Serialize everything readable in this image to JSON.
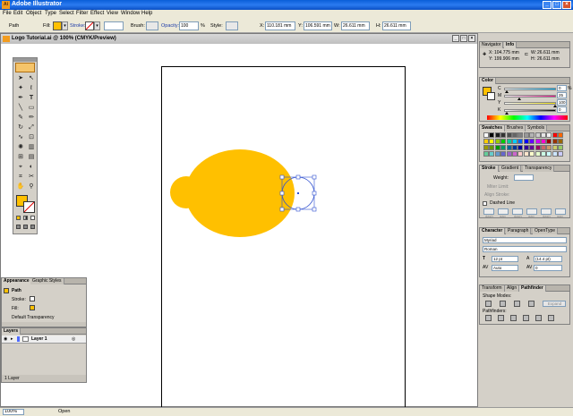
{
  "app": {
    "title": "Adobe Illustrator",
    "logo": "Ai"
  },
  "menu": [
    "File",
    "Edit",
    "Object",
    "Type",
    "Select",
    "Filter",
    "Effect",
    "View",
    "Window",
    "Help"
  ],
  "control": {
    "object_type": "Path",
    "fill_label": "Fill:",
    "fill_color": "#ffc000",
    "stroke_label": "Stroke:",
    "brush_label": "Brush:",
    "opacity_label": "Opacity:",
    "opacity_value": "100",
    "opacity_unit": "%",
    "style_label": "Style:",
    "x_label": "X:",
    "x_value": "110.181 mm",
    "y_label": "Y:",
    "y_value": "106.591 mm",
    "w_label": "W:",
    "w_value": "26.611 mm",
    "h_label": "H:",
    "h_value": "26.611 mm"
  },
  "document": {
    "title": "Logo Tutorial.ai @ 100% (CMYK/Preview)",
    "shape_color": "#ffc000"
  },
  "status": {
    "zoom": "100%",
    "info": "Open"
  },
  "navigator_panel": {
    "tabs": [
      "Navigator",
      "Info"
    ],
    "x_label": "X:",
    "x_value": "104.775 mm",
    "y_label": "Y:",
    "y_value": "199.906 mm",
    "w_label": "W:",
    "w_value": "26.611 mm",
    "h_label": "H:",
    "h_value": "26.611 mm"
  },
  "color_panel": {
    "tab": "Color",
    "channels": [
      {
        "label": "C",
        "value": "0",
        "color": "#00a8e8"
      },
      {
        "label": "M",
        "value": "25",
        "color": "#e8128a"
      },
      {
        "label": "Y",
        "value": "100",
        "color": "#f0e010"
      },
      {
        "label": "K",
        "value": "0",
        "color": "#000000"
      }
    ],
    "unit": "%"
  },
  "swatches_panel": {
    "tabs": [
      "Swatches",
      "Brushes",
      "Symbols"
    ],
    "colors": [
      "#ffffff",
      "#000000",
      "#1a1a1a",
      "#333333",
      "#4d4d4d",
      "#666666",
      "#808080",
      "#999999",
      "#b3b3b3",
      "#cccccc",
      "#e6e6e6",
      "#f2f2f2",
      "#ff0000",
      "#ff6600",
      "#ffcc00",
      "#ffff00",
      "#99cc00",
      "#00cc00",
      "#00cc99",
      "#00ccff",
      "#0066ff",
      "#0000ff",
      "#6600ff",
      "#cc00ff",
      "#ff00cc",
      "#990000",
      "#993300",
      "#996600",
      "#999900",
      "#669900",
      "#009900",
      "#009966",
      "#006699",
      "#003399",
      "#000099",
      "#330099",
      "#660099",
      "#990066",
      "#cc6666",
      "#cc9966",
      "#cccc66",
      "#99cc66",
      "#66cc99",
      "#66cccc",
      "#6699cc",
      "#6666cc",
      "#9966cc",
      "#cc66cc",
      "#ffcccc",
      "#ffe5cc",
      "#ffffcc",
      "#e5ffcc",
      "#ccffe5",
      "#ccffff",
      "#cce5ff",
      "#ccccff"
    ]
  },
  "stroke_panel": {
    "tabs": [
      "Stroke",
      "Gradient",
      "Transparency"
    ],
    "weight_label": "Weight:",
    "miter_label": "Miter Limit:",
    "align_label": "Align Stroke:",
    "dashed_label": "Dashed Line",
    "dash_labels": [
      "dash",
      "gap",
      "dash",
      "gap",
      "dash",
      "gap"
    ]
  },
  "character_panel": {
    "tabs": [
      "Character",
      "Paragraph",
      "OpenType"
    ],
    "font": "Myriad",
    "style": "Roman",
    "size": "12 pt",
    "leading": "(14.4 pt)",
    "kerning": "Auto",
    "tracking": "0"
  },
  "pathfinder_panel": {
    "tabs": [
      "Transform",
      "Align",
      "Pathfinder"
    ],
    "shape_modes_label": "Shape Modes:",
    "expand_label": "Expand",
    "pathfinders_label": "Pathfinders:"
  },
  "appearance_panel": {
    "tabs": [
      "Appearance",
      "Graphic Styles"
    ],
    "title": "Path",
    "stroke_label": "Stroke:",
    "fill_label": "Fill:",
    "transparency_label": "Default Transparency"
  },
  "layers_panel": {
    "tab": "Layers",
    "layer_name": "Layer 1",
    "footer": "1 Layer",
    "layer_color": "#4f6bff"
  }
}
